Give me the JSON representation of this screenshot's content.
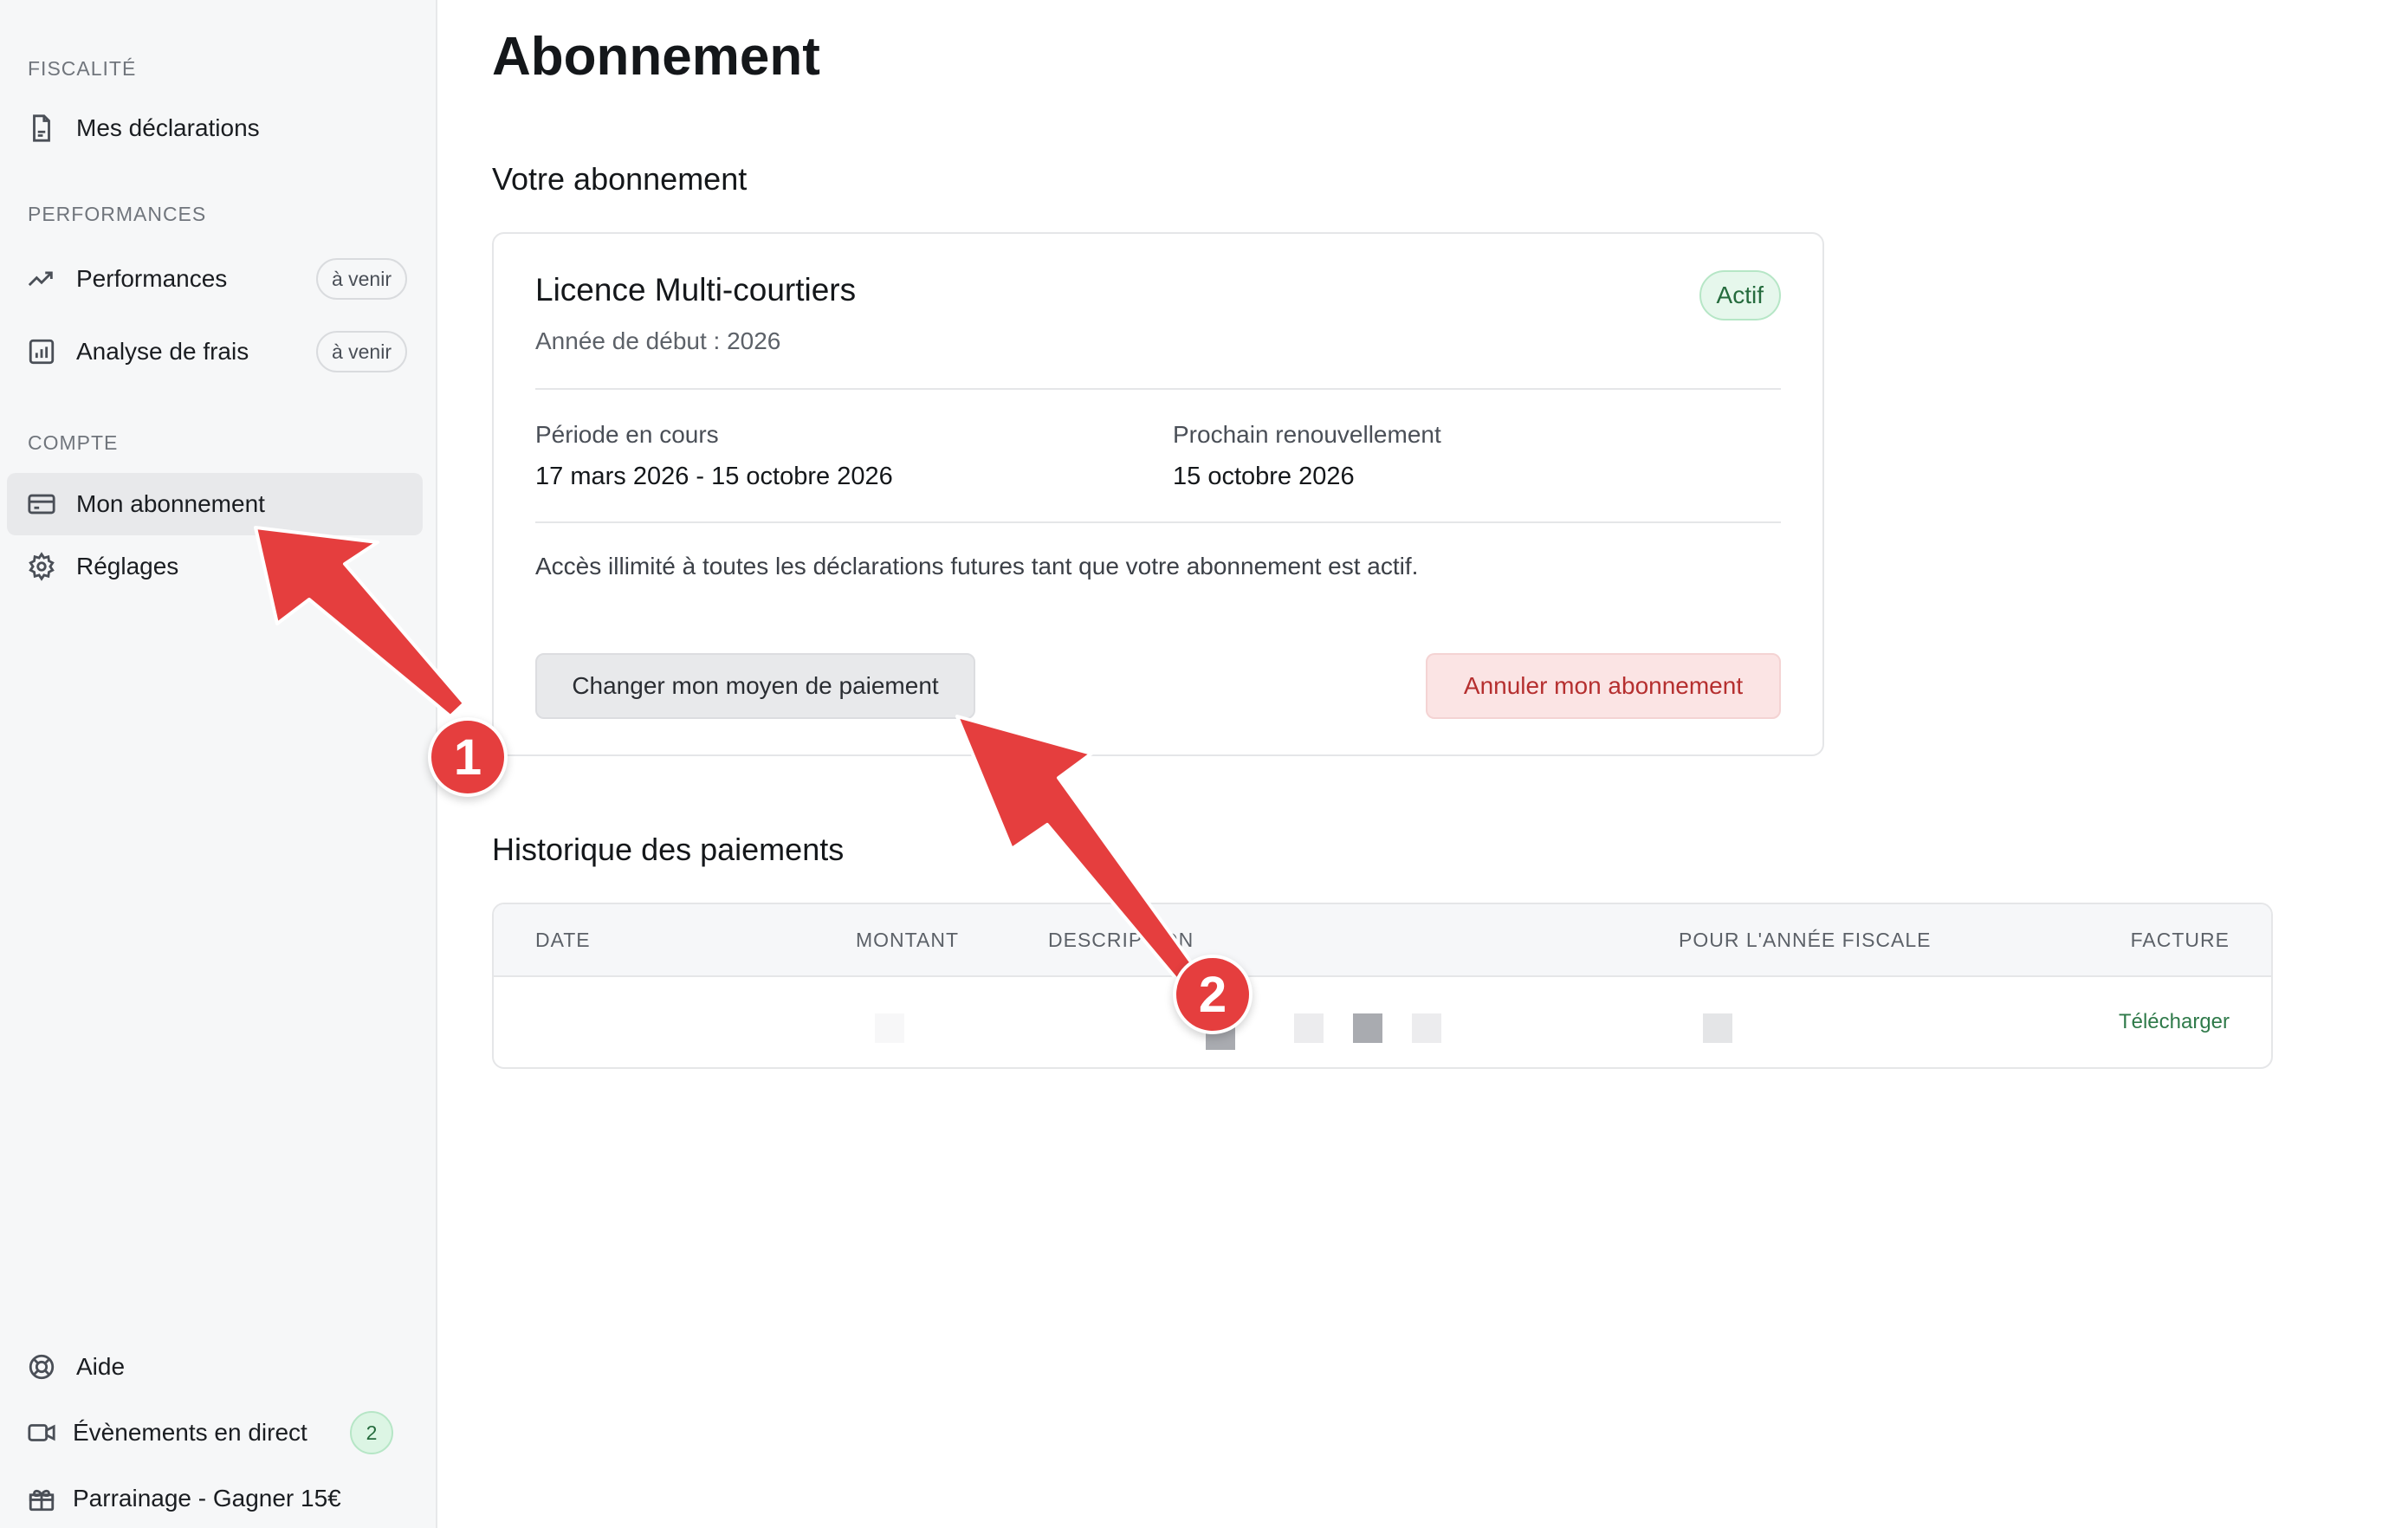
{
  "sidebar": {
    "sections": {
      "fiscalite": "FISCALITÉ",
      "performances": "PERFORMANCES",
      "compte": "COMPTE"
    },
    "items": [
      {
        "label": "Mes déclarations",
        "icon": "document-icon"
      },
      {
        "label": "Performances",
        "icon": "trend-up-icon",
        "badge": "à venir"
      },
      {
        "label": "Analyse de frais",
        "icon": "bar-chart-icon",
        "badge": "à venir"
      },
      {
        "label": "Mon abonnement",
        "icon": "credit-card-icon",
        "active": true
      },
      {
        "label": "Réglages",
        "icon": "gear-icon"
      }
    ],
    "footer": [
      {
        "label": "Aide",
        "icon": "lifebuoy-icon"
      },
      {
        "label": "Évènements en direct",
        "icon": "video-icon",
        "count": "2"
      },
      {
        "label": "Parrainage - Gagner 15€",
        "icon": "gift-icon"
      }
    ]
  },
  "main": {
    "title": "Abonnement",
    "subscription_heading": "Votre abonnement",
    "card": {
      "title": "Licence Multi-courtiers",
      "subtitle": "Année de début : 2026",
      "status": "Actif",
      "current_period_label": "Période en cours",
      "current_period_value": "17 mars 2026 - 15 octobre 2026",
      "renewal_label": "Prochain renouvellement",
      "renewal_value": "15 octobre 2026",
      "note": "Accès illimité à toutes les déclarations futures tant que votre abonnement est actif.",
      "change_payment_button": "Changer mon moyen de paiement",
      "cancel_button": "Annuler mon abonnement"
    },
    "history_heading": "Historique des paiements",
    "table": {
      "headers": [
        "DATE",
        "MONTANT",
        "DESCRIPTION",
        "POUR L'ANNÉE FISCALE",
        "FACTURE"
      ],
      "rows": [
        {
          "invoice_link": "Télécharger"
        }
      ]
    }
  },
  "annotations": [
    {
      "number": "1",
      "target": "Mon abonnement"
    },
    {
      "number": "2",
      "target": "Changer mon moyen de paiement"
    }
  ],
  "colors": {
    "accent_green": "#256b3d",
    "danger_red": "#b52f2f",
    "annotation_red": "#e53e3e",
    "sidebar_bg": "#f6f7f8"
  }
}
